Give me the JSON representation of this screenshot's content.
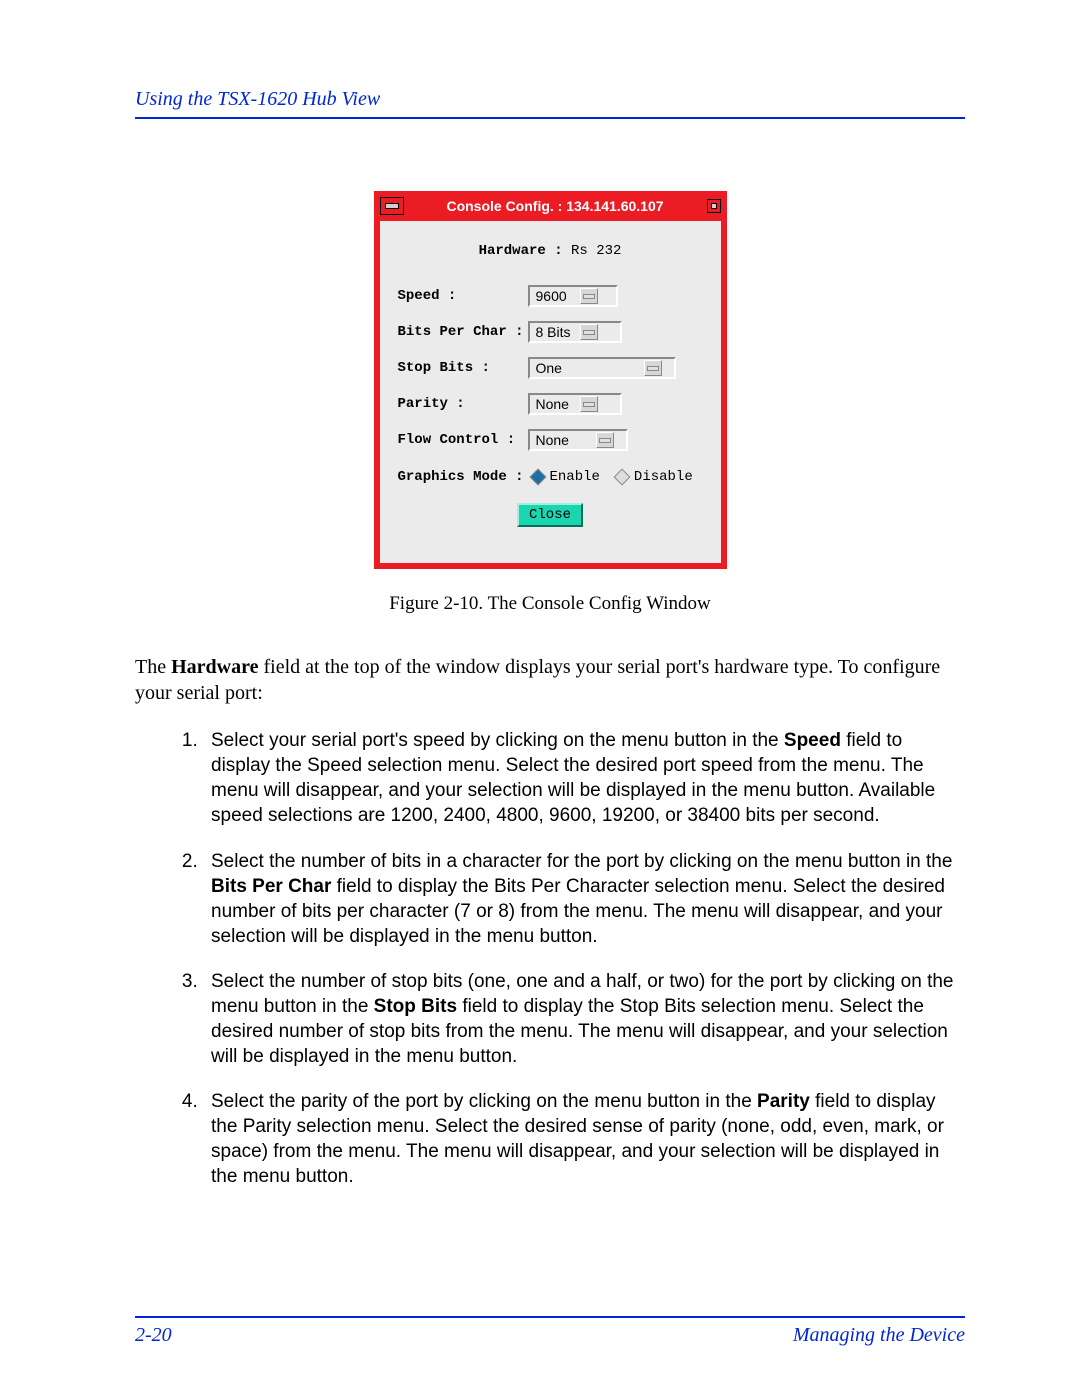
{
  "header": {
    "title": "Using the TSX-1620 Hub View"
  },
  "figure": {
    "titlebar": "Console Config. : 134.141.60.107",
    "hardware_label": "Hardware :",
    "hardware_value": "Rs 232",
    "fields": {
      "speed": {
        "label": "Speed :",
        "value": "9600"
      },
      "bpc": {
        "label": "Bits Per Char :",
        "value": "8 Bits"
      },
      "stop": {
        "label": "Stop Bits :",
        "value": "One"
      },
      "parity": {
        "label": "Parity :",
        "value": "None"
      },
      "flow": {
        "label": "Flow Control :",
        "value": "None"
      }
    },
    "graphics_mode": {
      "label": "Graphics Mode :",
      "enable": "Enable",
      "disable": "Disable"
    },
    "close": "Close",
    "caption": "Figure 2-10. The Console Config Window"
  },
  "body": {
    "hardware_bold": "Hardware",
    "intro_rest": " field at the top of the window displays your serial port's hardware type. To configure your serial port:",
    "steps": [
      {
        "pre": "Select your serial port's speed by clicking on the menu button in the ",
        "bold": "Speed",
        "post": " field to display the Speed selection menu. Select the desired port speed from the menu. The menu will disappear, and your selection will be displayed in the menu button. Available speed selections are 1200, 2400, 4800, 9600, 19200, or 38400 bits per second."
      },
      {
        "pre": "Select the number of bits in a character for the port by clicking on the menu button in the ",
        "bold": "Bits Per Char",
        "post": " field to display the Bits Per Character selection menu. Select the desired number of bits per character (7 or 8) from the menu. The menu will disappear, and your selection will be displayed in the menu button."
      },
      {
        "pre": "Select the number of stop bits (one, one and a half, or two) for the port by clicking on the menu button in the ",
        "bold": "Stop Bits",
        "post": " field to display the Stop Bits selection menu. Select the desired number of stop bits from the menu. The menu will disappear, and your selection will be displayed in the menu button."
      },
      {
        "pre": "Select the parity of the port by clicking on the menu button in the ",
        "bold": "Parity",
        "post": " field to display the Parity selection menu. Select the desired sense of parity (none, odd, even, mark, or space) from the menu. The menu will disappear, and your selection will be displayed in the menu button."
      }
    ]
  },
  "footer": {
    "page": "2-20",
    "section": "Managing the Device"
  }
}
